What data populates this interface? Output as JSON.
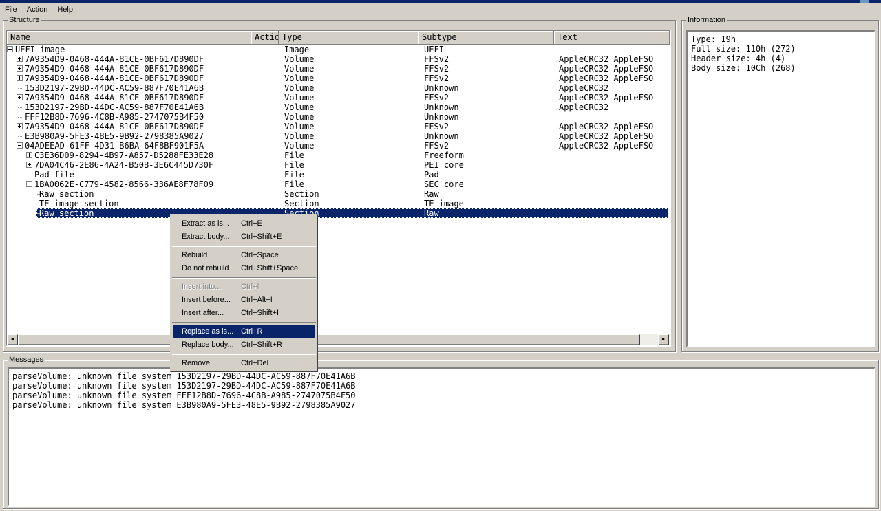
{
  "window": {
    "accent_color": "#0a246a",
    "chrome_color": "#d4d0c8"
  },
  "menu_bar": {
    "items": [
      "File",
      "Action",
      "Help"
    ]
  },
  "structure_panel": {
    "label": "Structure",
    "columns": [
      "Name",
      "Actio",
      "Type",
      "Subtype",
      "Text"
    ],
    "rows": [
      {
        "level": 0,
        "glyph": "minus",
        "name": "UEFI image",
        "type": "Image",
        "subtype": "UEFI",
        "text": "",
        "selected": false
      },
      {
        "level": 1,
        "glyph": "plus",
        "name": "7A9354D9-0468-444A-81CE-0BF617D890DF",
        "type": "Volume",
        "subtype": "FFSv2",
        "text": "AppleCRC32 AppleFSO",
        "selected": false
      },
      {
        "level": 1,
        "glyph": "plus",
        "name": "7A9354D9-0468-444A-81CE-0BF617D890DF",
        "type": "Volume",
        "subtype": "FFSv2",
        "text": "AppleCRC32 AppleFSO",
        "selected": false
      },
      {
        "level": 1,
        "glyph": "plus",
        "name": "7A9354D9-0468-444A-81CE-0BF617D890DF",
        "type": "Volume",
        "subtype": "FFSv2",
        "text": "AppleCRC32 AppleFSO",
        "selected": false
      },
      {
        "level": 1,
        "glyph": "none",
        "name": "153D2197-29BD-44DC-AC59-887F70E41A6B",
        "type": "Volume",
        "subtype": "Unknown",
        "text": "AppleCRC32",
        "selected": false
      },
      {
        "level": 1,
        "glyph": "plus",
        "name": "7A9354D9-0468-444A-81CE-0BF617D890DF",
        "type": "Volume",
        "subtype": "FFSv2",
        "text": "AppleCRC32 AppleFSO",
        "selected": false
      },
      {
        "level": 1,
        "glyph": "none",
        "name": "153D2197-29BD-44DC-AC59-887F70E41A6B",
        "type": "Volume",
        "subtype": "Unknown",
        "text": "AppleCRC32",
        "selected": false
      },
      {
        "level": 1,
        "glyph": "none",
        "name": "FFF12B8D-7696-4C8B-A985-2747075B4F50",
        "type": "Volume",
        "subtype": "Unknown",
        "text": "",
        "selected": false
      },
      {
        "level": 1,
        "glyph": "plus",
        "name": "7A9354D9-0468-444A-81CE-0BF617D890DF",
        "type": "Volume",
        "subtype": "FFSv2",
        "text": "AppleCRC32 AppleFSO",
        "selected": false
      },
      {
        "level": 1,
        "glyph": "none",
        "name": "E3B980A9-5FE3-48E5-9B92-2798385A9027",
        "type": "Volume",
        "subtype": "Unknown",
        "text": "AppleCRC32 AppleFSO",
        "selected": false
      },
      {
        "level": 1,
        "glyph": "minus",
        "name": "04ADEEAD-61FF-4D31-B6BA-64F8BF901F5A",
        "type": "Volume",
        "subtype": "FFSv2",
        "text": "AppleCRC32 AppleFSO",
        "selected": false
      },
      {
        "level": 2,
        "glyph": "plus",
        "name": "C3E36D09-8294-4B97-A857-D5288FE33E28",
        "type": "File",
        "subtype": "Freeform",
        "text": "",
        "selected": false
      },
      {
        "level": 2,
        "glyph": "plus",
        "name": "7DA04C46-2E86-4A24-B50B-3E6C445D730F",
        "type": "File",
        "subtype": "PEI core",
        "text": "",
        "selected": false
      },
      {
        "level": 2,
        "glyph": "none",
        "name": "Pad-file",
        "type": "File",
        "subtype": "Pad",
        "text": "",
        "selected": false
      },
      {
        "level": 2,
        "glyph": "minus",
        "name": "1BA0062E-C779-4582-8566-336AE8F78F09",
        "type": "File",
        "subtype": "SEC core",
        "text": "",
        "selected": false
      },
      {
        "level": 3,
        "glyph": "none",
        "name": "Raw section",
        "type": "Section",
        "subtype": "Raw",
        "text": "",
        "selected": false
      },
      {
        "level": 3,
        "glyph": "none",
        "name": "TE image section",
        "type": "Section",
        "subtype": "TE image",
        "text": "",
        "selected": false
      },
      {
        "level": 3,
        "glyph": "none",
        "name": "Raw section",
        "type": "Section",
        "subtype": "Raw",
        "text": "",
        "selected": true
      }
    ]
  },
  "context_menu": {
    "items": [
      {
        "label": "Extract as is...",
        "shortcut": "Ctrl+E",
        "state": "normal"
      },
      {
        "label": "Extract body...",
        "shortcut": "Ctrl+Shift+E",
        "state": "normal"
      },
      {
        "separator": true
      },
      {
        "label": "Rebuild",
        "shortcut": "Ctrl+Space",
        "state": "normal"
      },
      {
        "label": "Do not rebuild",
        "shortcut": "Ctrl+Shift+Space",
        "state": "normal"
      },
      {
        "separator": true
      },
      {
        "label": "Insert into...",
        "shortcut": "Ctrl+I",
        "state": "disabled"
      },
      {
        "label": "Insert before...",
        "shortcut": "Ctrl+Alt+I",
        "state": "normal"
      },
      {
        "label": "Insert after...",
        "shortcut": "Ctrl+Shift+I",
        "state": "normal"
      },
      {
        "separator": true
      },
      {
        "label": "Replace as is...",
        "shortcut": "Ctrl+R",
        "state": "highlighted"
      },
      {
        "label": "Replace body...",
        "shortcut": "Ctrl+Shift+R",
        "state": "normal"
      },
      {
        "separator": true
      },
      {
        "label": "Remove",
        "shortcut": "Ctrl+Del",
        "state": "normal"
      }
    ]
  },
  "information_panel": {
    "label": "Information",
    "lines": [
      "Type: 19h",
      "Full size: 110h (272)",
      "Header size: 4h (4)",
      "Body size: 10Ch (268)"
    ]
  },
  "messages_panel": {
    "label": "Messages",
    "lines": [
      "parseVolume: unknown file system 153D2197-29BD-44DC-AC59-887F70E41A6B",
      "parseVolume: unknown file system 153D2197-29BD-44DC-AC59-887F70E41A6B",
      "parseVolume: unknown file system FFF12B8D-7696-4C8B-A985-2747075B4F50",
      "parseVolume: unknown file system E3B980A9-5FE3-48E5-9B92-2798385A9027"
    ]
  },
  "scrollbar": {
    "left_arrow": "◄",
    "right_arrow": "►"
  }
}
